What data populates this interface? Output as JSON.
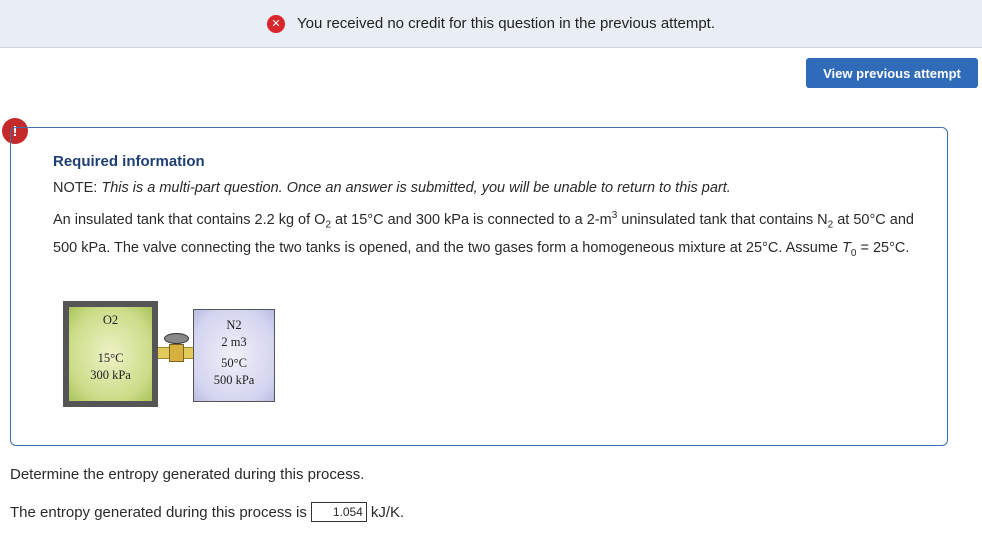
{
  "banner": {
    "message": "You received no credit for this question in the previous attempt."
  },
  "view_previous": {
    "label": "View previous attempt"
  },
  "alert": {
    "glyph": "!"
  },
  "info": {
    "title": "Required information",
    "note_prefix": "NOTE: ",
    "note_text": "This is a multi-part question. Once an answer is submitted, you will be unable to return to this part.",
    "problem": {
      "p1": "An insulated tank that contains 2.2 kg of O",
      "p1_sub": "2",
      "p2": " at 15°C and 300 kPa is connected to a 2-m",
      "p2_sup": "3",
      "p3": " uninsulated tank that contains N",
      "p3_sub": "2",
      "p4": " at 50°C and 500 kPa. The valve connecting the two tanks is opened, and the two gases form a homogeneous mixture at 25°C. Assume ",
      "t0": "T",
      "t0_sub": "0",
      "p5": " = 25°C."
    },
    "diagram": {
      "tank1": {
        "gas": "O2",
        "temp": "15°C",
        "pressure": "300 kPa"
      },
      "tank2": {
        "gas": "N2",
        "volume": "2 m3",
        "temp": "50°C",
        "pressure": "500 kPa"
      }
    }
  },
  "question": {
    "text": "Determine the entropy generated during this process."
  },
  "answer": {
    "prefix": "The entropy generated during this process is",
    "value": "1.054",
    "unit": "kJ/K."
  }
}
